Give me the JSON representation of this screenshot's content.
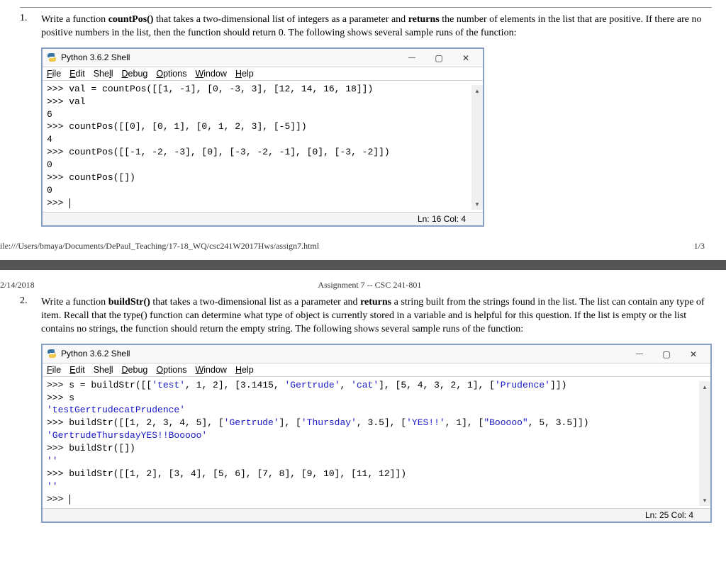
{
  "q1": {
    "num": "1.",
    "text_a": "Write a function ",
    "fn": "countPos()",
    "text_b": " that takes a two-dimensional list of integers as a parameter and ",
    "ret": "returns",
    "text_c": " the number of elements in the list that are positive. If there are no positive numbers in the list, then the function should return 0. The following shows several sample runs of the function:"
  },
  "q2": {
    "num": "2.",
    "text_a": "Write a function ",
    "fn": "buildStr()",
    "text_b": " that takes a two-dimensional list as a parameter and ",
    "ret": "returns",
    "text_c": " a string built from the strings found in the list. The list can contain any type of item. Recall that the type() function can determine what type of object is currently stored in a variable and is helpful for this question. If the list is empty or the list contains no strings, the function should return the empty string. The following shows several sample runs of the function:"
  },
  "shell": {
    "title": "Python 3.6.2 Shell",
    "menu": [
      "File",
      "Edit",
      "Shell",
      "Debug",
      "Options",
      "Window",
      "Help"
    ]
  },
  "shell1": {
    "body": ">>> val = countPos([[1, -1], [0, -3, 3], [12, 14, 16, 18]])\n>>> val\n6\n>>> countPos([[0], [0, 1], [0, 1, 2, 3], [-5]])\n4\n>>> countPos([[-1, -2, -3], [0], [-3, -2, -1], [0], [-3, -2]])\n0\n>>> countPos([])\n0\n>>> ",
    "status": "Ln: 16  Col: 4"
  },
  "shell2": {
    "line1a": ">>> s = buildStr([[",
    "s1": "'test'",
    "line1b": ", 1, 2], [3.1415, ",
    "s2": "'Gertrude'",
    "line1c": ", ",
    "s3": "'cat'",
    "line1d": "], [5, 4, 3, 2, 1], [",
    "s4": "'Prudence'",
    "line1e": "]])",
    "line2": ">>> s",
    "out1": "'testGertrudecatPrudence'",
    "line3a": ">>> buildStr([[1, 2, 3, 4, 5], [",
    "s5": "'Gertrude'",
    "line3b": "], [",
    "s6": "'Thursday'",
    "line3c": ", 3.5], [",
    "s7": "'YES!!'",
    "line3d": ", 1], [",
    "s8": "\"Booooo\"",
    "line3e": ", 5, 3.5]])",
    "out2": "'GertrudeThursdayYES!!Booooo'",
    "line4": ">>> buildStr([])",
    "out3": "''",
    "line5": ">>> buildStr([[1, 2], [3, 4], [5, 6], [7, 8], [9, 10], [11, 12]])",
    "out4": "''",
    "prompt": ">>> ",
    "status": "Ln: 25  Col: 4"
  },
  "footer": {
    "path": "ile:///Users/bmaya/Documents/DePaul_Teaching/17-18_WQ/csc241W2017Hws/assign7.html",
    "page": "1/3"
  },
  "header2": {
    "date": "2/14/2018",
    "title": "Assignment 7 -- CSC 241-801"
  }
}
